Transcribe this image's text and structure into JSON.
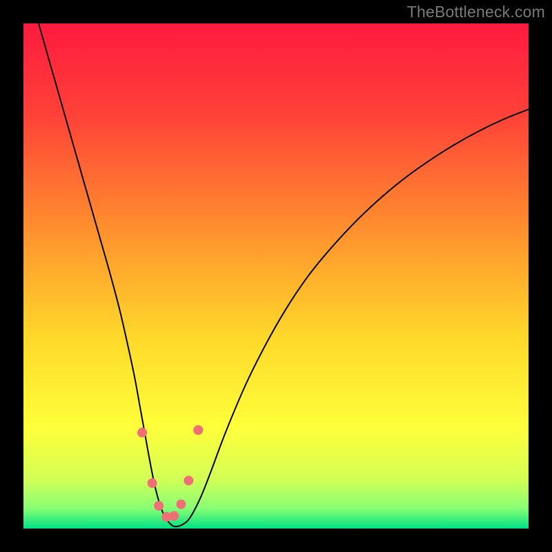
{
  "watermark": "TheBottleneck.com",
  "chart_data": {
    "type": "line",
    "title": "",
    "xlabel": "",
    "ylabel": "",
    "xlim": [
      0,
      100
    ],
    "ylim": [
      0,
      100
    ],
    "grid": false,
    "legend": false,
    "background_gradient": {
      "stops": [
        {
          "offset": 0.0,
          "color": "#ff1a3f"
        },
        {
          "offset": 0.18,
          "color": "#ff4138"
        },
        {
          "offset": 0.4,
          "color": "#ff8d2e"
        },
        {
          "offset": 0.62,
          "color": "#ffd82a"
        },
        {
          "offset": 0.8,
          "color": "#ffff3a"
        },
        {
          "offset": 0.9,
          "color": "#d4ff55"
        },
        {
          "offset": 0.96,
          "color": "#88ff74"
        },
        {
          "offset": 1.0,
          "color": "#00e084"
        }
      ]
    },
    "series": [
      {
        "name": "bottleneck-curve",
        "color": "#000000",
        "stroke_width": 2,
        "x": [
          3,
          5,
          7,
          9,
          11,
          13,
          15,
          17,
          19,
          20.5,
          22,
          23,
          24,
          25,
          26,
          27,
          28,
          29,
          30,
          31.5,
          33,
          35,
          37,
          40,
          44,
          48,
          52,
          56,
          60,
          65,
          70,
          75,
          80,
          85,
          90,
          95,
          100
        ],
        "y": [
          100,
          93,
          86,
          79,
          72,
          65,
          58,
          51,
          43.5,
          37,
          30,
          24.5,
          19,
          13.5,
          8.5,
          4.8,
          2.3,
          1.0,
          0.4,
          0.8,
          2.2,
          6.0,
          11.0,
          19.0,
          28.5,
          36.5,
          43.5,
          49.5,
          54.5,
          60.0,
          64.8,
          69.0,
          72.6,
          75.8,
          78.6,
          81.0,
          83.0
        ]
      }
    ],
    "markers": {
      "name": "highlight-points",
      "color": "#ef6f74",
      "radius": 7,
      "points": [
        {
          "x": 23.5,
          "y": 19
        },
        {
          "x": 25.5,
          "y": 9
        },
        {
          "x": 26.8,
          "y": 4.5
        },
        {
          "x": 28.3,
          "y": 2.3
        },
        {
          "x": 29.8,
          "y": 2.5
        },
        {
          "x": 31.2,
          "y": 4.8
        },
        {
          "x": 32.7,
          "y": 9.5
        },
        {
          "x": 34.6,
          "y": 19.5
        }
      ]
    }
  }
}
